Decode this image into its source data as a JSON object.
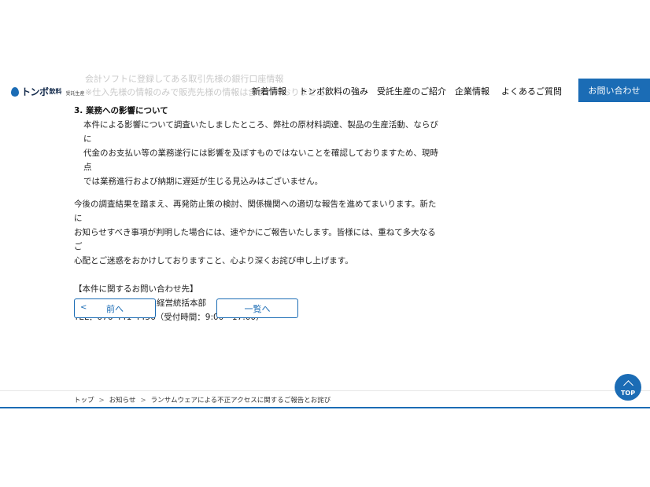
{
  "faded_text": {
    "line1": "会計ソフトに登録してある取引先様の銀行口座情報",
    "line2": "※仕入先様の情報のみで販売先様の情報は含まれておりません。"
  },
  "header": {
    "logo_brand": "トンボ",
    "logo_brand2": "飲料",
    "logo_sub": "受託生産",
    "nav": [
      "新着情報",
      "トンボ飲料の強み",
      "受託生産のご紹介",
      "企業情報",
      "よくあるご質問"
    ],
    "contact_label": "お問い合わせ",
    "brand_color": "#1b6cb5"
  },
  "article": {
    "section3_title": "3. 業務への影響について",
    "section3_lines": [
      "本件による影響について調査いたしましたところ、弊社の原材料調達、製品の生産活動、ならびに",
      "代金のお支払い等の業務遂行には影響を及ぼすものではないことを確認しておりますため、現時点",
      "では業務進行および納期に遅延が生じる見込みはございません。"
    ],
    "closing_lines": [
      "今後の調査結果を踏まえ、再発防止策の検討、関係機関への適切な報告を進めてまいります。新たに",
      "お知らせすべき事項が判明した場合には、速やかにご報告いたします。皆様には、重ねて多大なるご",
      "心配とご迷惑をおかけしておりますこと、心より深くお詫び申し上げます。"
    ],
    "contact_heading": "【本件に関するお問い合わせ先】",
    "contact_company": "株式会社トンボ飲料　経営統括本部",
    "contact_tel": "TEL：076-441-4456（受付時間：9:00〜17:00）"
  },
  "pager": {
    "prev_chevron": "<",
    "prev_label": "前へ",
    "list_label": "一覧へ"
  },
  "breadcrumb": {
    "sep": ">",
    "items": [
      "トップ",
      "お知らせ",
      "ランサムウェアによる不正アクセスに関するご報告とお詫び"
    ]
  },
  "top_button": {
    "label": "TOP",
    "icon": "chevron-up-icon"
  }
}
